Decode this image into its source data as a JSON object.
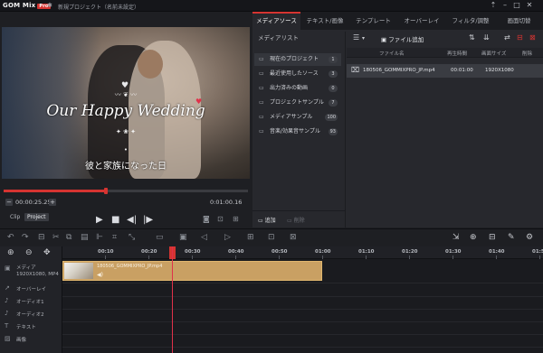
{
  "titlebar": {
    "logo": "GOM Mix",
    "logo_badge": "Pro",
    "document": "新規プロジェクト（名前未設定）"
  },
  "preview": {
    "headline": "Our Happy Wedding",
    "ornament_top": "〰 ❦ 〰",
    "ornament_bottom": "✦ ❀ ✦",
    "subtitle": "彼と家族になった日",
    "progress_fraction": 0.42,
    "current_time": "00:00:25.25",
    "total_time": "0:01:00.16",
    "clip_tab": "Clip",
    "project_tab": "Project"
  },
  "tabs": [
    "メディアソース",
    "テキスト/画像",
    "テンプレート",
    "オーバーレイ",
    "フィルタ/調整",
    "画面切替"
  ],
  "media": {
    "list_title": "メディアリスト",
    "folders": [
      {
        "label": "現在のプロジェクト",
        "count": "1"
      },
      {
        "label": "最近使用したソース",
        "count": "3"
      },
      {
        "label": "出力済みの動画",
        "count": "0"
      },
      {
        "label": "プロジェクトサンプル",
        "count": "7"
      },
      {
        "label": "メディアサンプル",
        "count": "100"
      },
      {
        "label": "音楽/効果音サンプル",
        "count": "93"
      }
    ],
    "add_label": "追加",
    "delete_label": "削除",
    "add_file_label": "ファイル追加",
    "columns": [
      "ファイル名",
      "再生時間",
      "画面サイズ",
      "削除"
    ],
    "files": [
      {
        "name": "180506_GOMMIXPRO_JP.mp4",
        "duration": "00:01:00",
        "size": "1920X1080"
      }
    ]
  },
  "timeline": {
    "ticks": [
      "00:10",
      "00:20",
      "00:30",
      "00:40",
      "00:50",
      "01:00",
      "01:10",
      "01:20",
      "01:30",
      "01:40",
      "01:50"
    ],
    "tracks": [
      {
        "icon": "media-track-icon",
        "label": "メディア\n1920X1080, MP4"
      },
      {
        "icon": "overlay-track-icon",
        "label": "オーバーレイ"
      },
      {
        "icon": "audio-track-icon",
        "label": "オーディオ1"
      },
      {
        "icon": "audio-track-icon",
        "label": "オーディオ2"
      },
      {
        "icon": "text-track-icon",
        "label": "テキスト"
      },
      {
        "icon": "image-track-icon",
        "label": "画像"
      }
    ],
    "clip_name": "180506_GOMMIXPRO_JP.mp4",
    "clip_fraction": 0.54,
    "playhead_fraction": 0.228
  },
  "colors": {
    "accent": "#d63431",
    "clip": "#c9a063"
  }
}
